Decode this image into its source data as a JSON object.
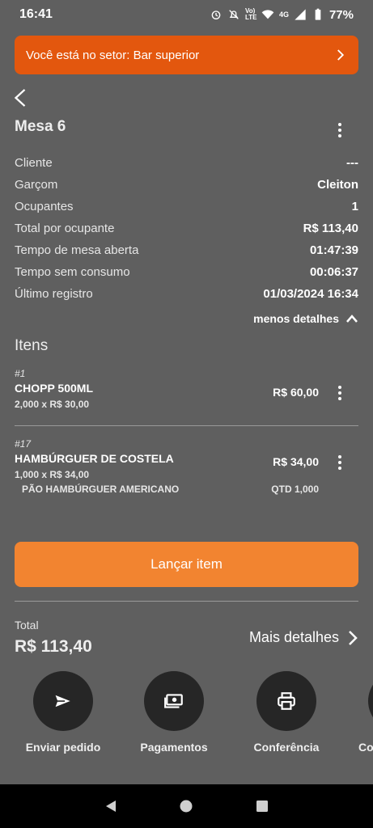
{
  "status_bar": {
    "time": "16:41",
    "network": "4G",
    "battery": "77%",
    "volte": "Vo) LTE"
  },
  "sector_banner": {
    "text": "Você está no setor: Bar superior"
  },
  "table": {
    "title": "Mesa 6"
  },
  "details": [
    {
      "label": "Cliente",
      "value": "---"
    },
    {
      "label": "Garçom",
      "value": "Cleiton"
    },
    {
      "label": "Ocupantes",
      "value": "1"
    },
    {
      "label": "Total por ocupante",
      "value": "R$ 113,40"
    },
    {
      "label": "Tempo de mesa aberta",
      "value": "01:47:39"
    },
    {
      "label": "Tempo sem consumo",
      "value": "00:06:37"
    },
    {
      "label": "Último registro",
      "value": "01/03/2024 16:34"
    }
  ],
  "toggle_details_label": "menos detalhes",
  "items_heading": "Itens",
  "items": [
    {
      "number": "#1",
      "name": "CHOPP 500ML",
      "quantity": "2,000 x R$ 30,00",
      "price": "R$ 60,00"
    },
    {
      "number": "#17",
      "name": "HAMBÚRGUER DE COSTELA",
      "quantity": "1,000 x R$ 34,00",
      "price": "R$ 34,00",
      "subitem": {
        "name": "PÃO HAMBÚRGUER AMERICANO",
        "qty": "QTD 1,000"
      }
    }
  ],
  "launch_button": "Lançar item",
  "total": {
    "label": "Total",
    "value": "R$ 113,40"
  },
  "more_details": "Mais detalhes",
  "actions": [
    {
      "label": "Enviar pedido",
      "icon": "send-icon"
    },
    {
      "label": "Pagamentos",
      "icon": "payments-icon"
    },
    {
      "label": "Conferência",
      "icon": "printer-icon"
    },
    {
      "label": "Co",
      "icon": "unknown-icon"
    }
  ],
  "colors": {
    "background": "#5f5f5f",
    "banner": "#e3570e",
    "accent_button": "#f28430",
    "action_circle": "#262626"
  }
}
